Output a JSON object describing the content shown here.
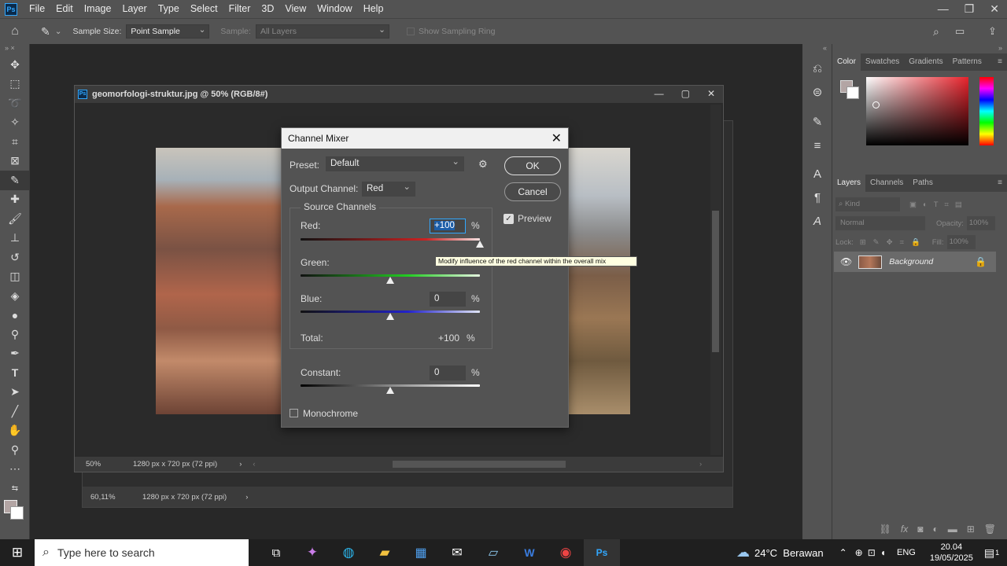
{
  "menubar": {
    "logo": "Ps",
    "items": [
      "File",
      "Edit",
      "Image",
      "Layer",
      "Type",
      "Select",
      "Filter",
      "3D",
      "View",
      "Window",
      "Help"
    ],
    "controls": [
      "—",
      "❐",
      "✕"
    ]
  },
  "options": {
    "sample_size_label": "Sample Size:",
    "sample_size_value": "Point Sample",
    "sample_label": "Sample:",
    "sample_value": "All Layers",
    "sampling_ring": "Show Sampling Ring"
  },
  "document": {
    "title": "geomorfologi-struktur.jpg @ 50% (RGB/8#)",
    "zoom": "50%",
    "size": "1280 px x 720 px (72 ppi)",
    "back_zoom": "60,11%",
    "back_size": "1280 px x 720 px (72 ppi)"
  },
  "dialog": {
    "title": "Channel Mixer",
    "preset_label": "Preset:",
    "preset_value": "Default",
    "output_label": "Output Channel:",
    "output_value": "Red",
    "source_label": "Source Channels",
    "red_label": "Red:",
    "red_value": "+100",
    "red_level": 1.0,
    "green_label": "Green:",
    "green_value": "0",
    "green_level": 0.0,
    "blue_label": "Blue:",
    "blue_value": "0",
    "blue_level": 0.0,
    "total_label": "Total:",
    "total_value": "+100",
    "total_unit": "%",
    "constant_label": "Constant:",
    "constant_value": "0",
    "constant_level": 0.0,
    "percent": "%",
    "monochrome_label": "Monochrome",
    "monochrome_checked": false,
    "ok_label": "OK",
    "cancel_label": "Cancel",
    "preview_label": "Preview",
    "preview_checked": true,
    "tooltip": "Modify influence of the red channel within the overall mix"
  },
  "color_panel": {
    "tabs": [
      "Color",
      "Swatches",
      "Gradients",
      "Patterns"
    ],
    "hue_color": "#e8232c"
  },
  "layers_panel": {
    "tabs": [
      "Layers",
      "Channels",
      "Paths"
    ],
    "kind_label": "Kind",
    "blend_mode": "Normal",
    "opacity_label": "Opacity:",
    "opacity_value": "100%",
    "lock_label": "Lock:",
    "fill_label": "Fill:",
    "fill_value": "100%",
    "layer_name": "Background"
  },
  "taskbar": {
    "search_placeholder": "Type here to search",
    "weather": "24°C  Berawan",
    "lang": "ENG",
    "time": "20.04",
    "date": "19/05/2025",
    "notif_count": "1"
  },
  "colors": {
    "accent": "#31a8ff",
    "panel": "#535353",
    "canvas": "#282828"
  }
}
